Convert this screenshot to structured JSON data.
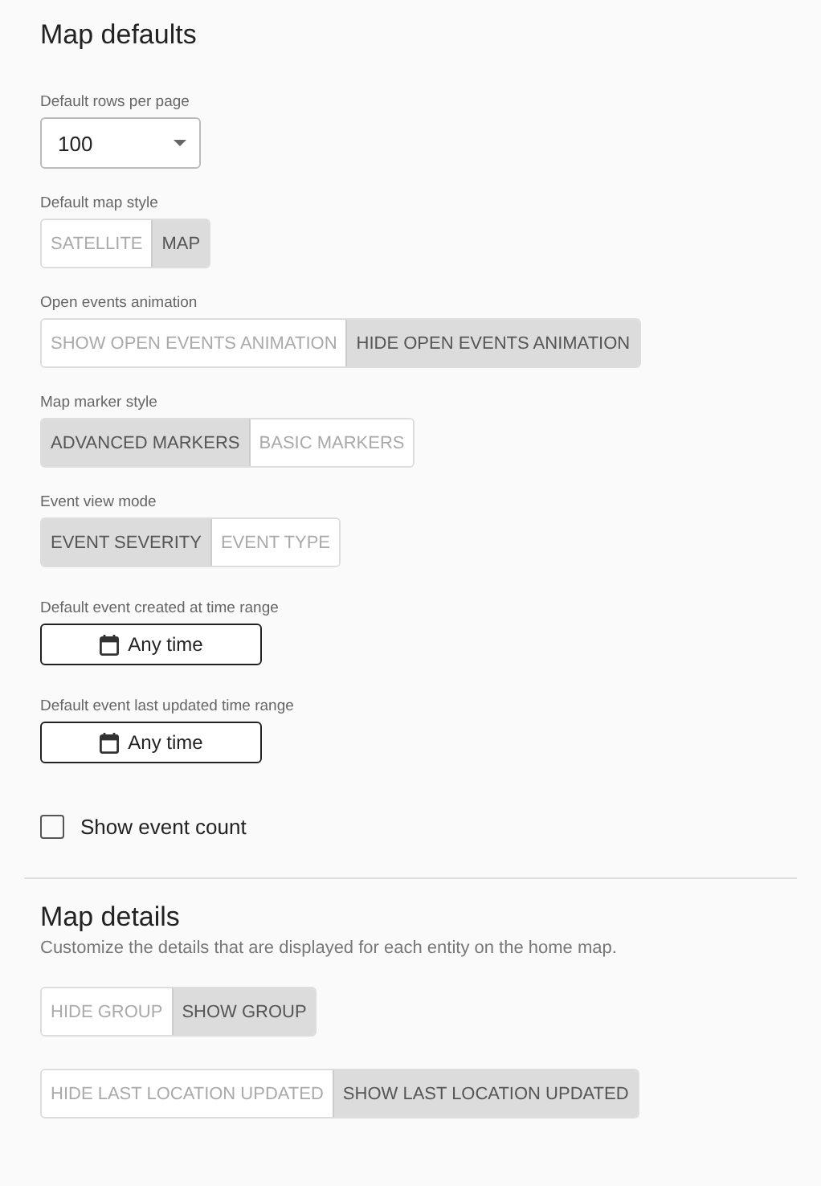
{
  "sections": [
    {
      "title": "Map defaults",
      "settings": [
        {
          "kind": "select",
          "label": "Default rows per page",
          "value": "100"
        },
        {
          "kind": "toggle",
          "label": "Default map style",
          "options": [
            {
              "label": "SATELLITE",
              "selected": false
            },
            {
              "label": "MAP",
              "selected": true
            }
          ]
        },
        {
          "kind": "toggle",
          "label": "Open events animation",
          "options": [
            {
              "label": "SHOW OPEN EVENTS ANIMATION",
              "selected": false
            },
            {
              "label": "HIDE OPEN EVENTS ANIMATION",
              "selected": true
            }
          ]
        },
        {
          "kind": "toggle",
          "label": "Map marker style",
          "options": [
            {
              "label": "ADVANCED MARKERS",
              "selected": true
            },
            {
              "label": "BASIC MARKERS",
              "selected": false
            }
          ]
        },
        {
          "kind": "toggle",
          "label": "Event view mode",
          "options": [
            {
              "label": "EVENT SEVERITY",
              "selected": true
            },
            {
              "label": "EVENT TYPE",
              "selected": false
            }
          ]
        },
        {
          "kind": "date",
          "label": "Default event created at time range",
          "value": "Any time"
        },
        {
          "kind": "date",
          "label": "Default event last updated time range",
          "value": "Any time"
        },
        {
          "kind": "checkbox",
          "label": "Show event count",
          "checked": false
        }
      ]
    },
    {
      "title": "Map details",
      "description": "Customize the details that are displayed for each entity on the home map.",
      "settings": [
        {
          "kind": "toggle",
          "options": [
            {
              "label": "HIDE GROUP",
              "selected": false
            },
            {
              "label": "SHOW GROUP",
              "selected": true
            }
          ]
        },
        {
          "kind": "toggle",
          "options": [
            {
              "label": "HIDE LAST LOCATION UPDATED",
              "selected": false
            },
            {
              "label": "SHOW LAST LOCATION UPDATED",
              "selected": true
            }
          ]
        }
      ]
    }
  ]
}
